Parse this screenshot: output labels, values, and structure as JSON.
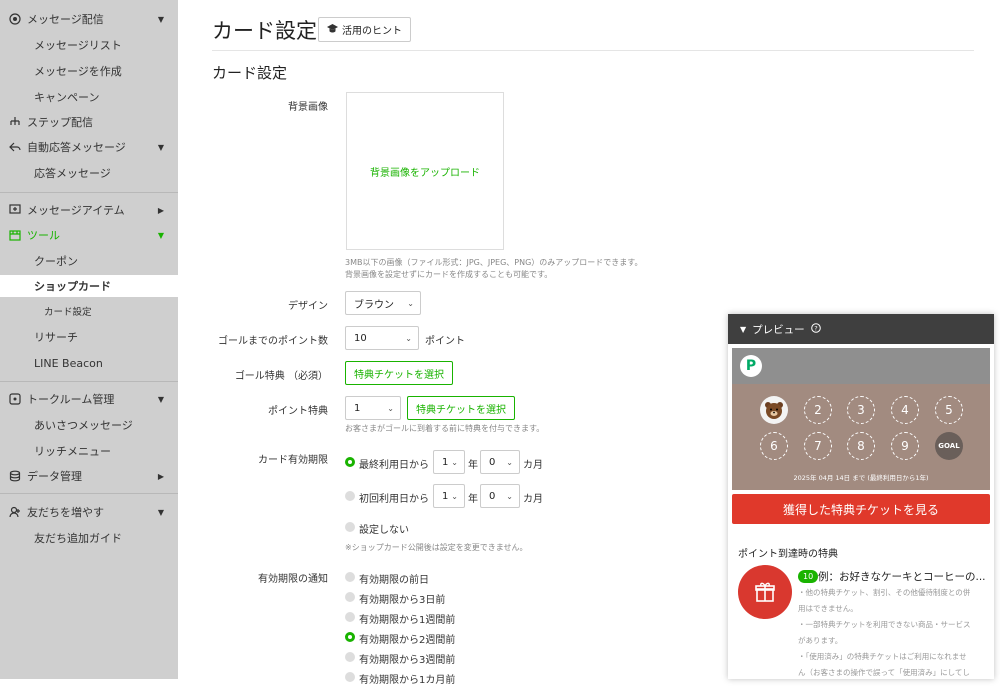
{
  "sidebar": {
    "message_delivery": "メッセージ配信",
    "message_list": "メッセージリスト",
    "create_message": "メッセージを作成",
    "campaign": "キャンペーン",
    "step_delivery": "ステップ配信",
    "auto_reply": "自動応答メッセージ",
    "reply_message": "応答メッセージ",
    "message_items": "メッセージアイテム",
    "tools": "ツール",
    "coupon": "クーポン",
    "shop_card": "ショップカード",
    "card_settings": "カード設定",
    "research": "リサーチ",
    "line_beacon": "LINE Beacon",
    "chat_management": "トークルーム管理",
    "greeting": "あいさつメッセージ",
    "rich_menu": "リッチメニュー",
    "data_management": "データ管理",
    "grow_friends": "友だちを増やす",
    "friend_guide": "友だち追加ガイド"
  },
  "header": {
    "title": "カード設定",
    "hint": "活用のヒント"
  },
  "form": {
    "section_title": "カード設定",
    "bg_label": "背景画像",
    "bg_upload": "背景画像をアップロード",
    "bg_note1": "3MB以下の画像（ファイル形式：JPG、JPEG、PNG）のみアップロードできます。",
    "bg_note2": "背景画像を設定せずにカードを作成することも可能です。",
    "design_label": "デザイン",
    "design_value": "ブラウン",
    "goal_points_label": "ゴールまでのポイント数",
    "goal_points_value": "10",
    "points_unit": "ポイント",
    "goal_reward_label": "ゴール特典 （必須）",
    "select_ticket": "特典チケットを選択",
    "point_reward_label": "ポイント特典",
    "point_reward_value": "1",
    "point_reward_note": "お客さまがゴールに到着する前に特典を付与できます。",
    "validity_label": "カード有効期限",
    "opt_last_use": "最終利用日から",
    "opt_first_use": "初回利用日から",
    "years_value": "1",
    "year_unit": "年",
    "months_value": "0",
    "month_unit": "カ月",
    "opt_none": "設定しない",
    "validity_note": "※ショップカード公開後は設定を変更できません。",
    "notify_label": "有効期限の通知",
    "notify_opts": [
      "有効期限の前日",
      "有効期限から3日前",
      "有効期限から1週間前",
      "有効期限から2週間前",
      "有効期限から3週間前",
      "有効期限から1カ月前"
    ]
  },
  "preview": {
    "title": "プレビュー",
    "logo": "P",
    "stamps": [
      "2",
      "3",
      "4",
      "5",
      "6",
      "7",
      "8",
      "9",
      "GOAL"
    ],
    "date": "2025年 04月 14日 まで (最終利用日から1年)",
    "view_tickets": "獲得した特典チケットを見る",
    "section": "ポイント到達時の特典",
    "badge": "10",
    "reward_title": "例：お好きなケーキとコーヒーの...",
    "line1": "・他の特典チケット、割引、その他優待制度との併",
    "line2": "用はできません。",
    "line3": "・一部特典チケットを利用できない商品・サービス",
    "line4": "があります。",
    "line5": "・「使用済み」の特典チケットはご利用になれませ",
    "line6": "ん（お客さまの操作で誤って「使用済み」にしてし"
  },
  "colors": {
    "accent": "#19b300",
    "red": "#e0392b",
    "sidebar_bg": "#cfcfcf"
  }
}
